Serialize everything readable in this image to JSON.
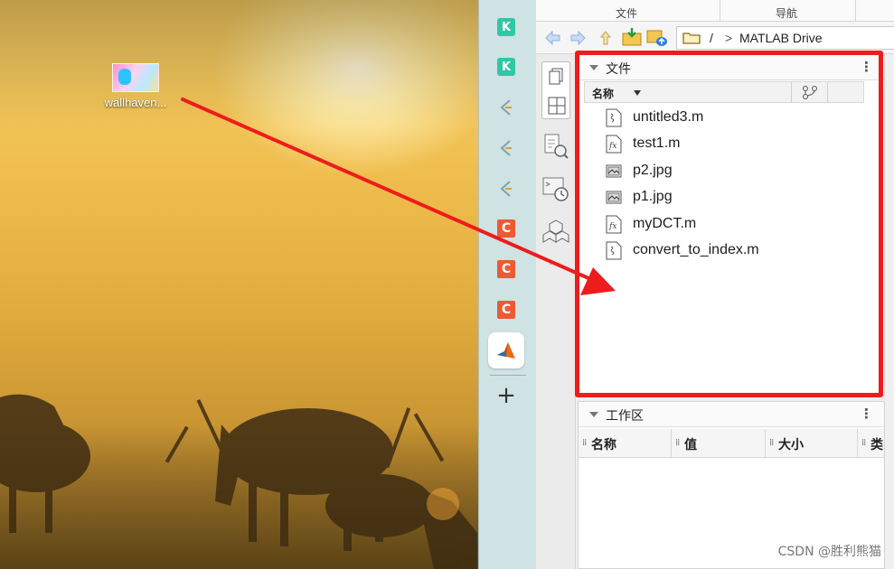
{
  "desktop": {
    "icon_label": "wallhaven..."
  },
  "dock": {
    "items": [
      {
        "name": "k",
        "glyph": "K"
      },
      {
        "name": "k",
        "glyph": "K"
      },
      {
        "name": "q",
        "glyph": "⟨"
      },
      {
        "name": "q",
        "glyph": "⟨"
      },
      {
        "name": "q",
        "glyph": "⟨"
      },
      {
        "name": "c",
        "glyph": "C"
      },
      {
        "name": "c",
        "glyph": "C"
      },
      {
        "name": "c",
        "glyph": "C"
      }
    ],
    "add_glyph": "+"
  },
  "matlab": {
    "tabs": [
      "文件",
      "导航"
    ],
    "address": {
      "root": "/",
      "separator": ">",
      "location": "MATLAB Drive"
    },
    "files_panel": {
      "title": "文件",
      "menu_glyph": "⋮",
      "column_name": "名称",
      "files": [
        {
          "name": "untitled3.m",
          "kind": "script"
        },
        {
          "name": "test1.m",
          "kind": "function"
        },
        {
          "name": "p2.jpg",
          "kind": "image"
        },
        {
          "name": "p1.jpg",
          "kind": "image"
        },
        {
          "name": "myDCT.m",
          "kind": "function"
        },
        {
          "name": "convert_to_index.m",
          "kind": "script"
        }
      ]
    },
    "workspace_panel": {
      "title": "工作区",
      "menu_glyph": "⋮",
      "columns": [
        "名称",
        "值",
        "大小",
        "类"
      ]
    },
    "rail_more": "·· "
  },
  "colors": {
    "highlight": "#ee1c1c",
    "dock_bg": "#cfe2e4",
    "k_icon": "#2ec8a4",
    "c_icon": "#ee5a32"
  },
  "watermark": "CSDN @胜利熊猫"
}
